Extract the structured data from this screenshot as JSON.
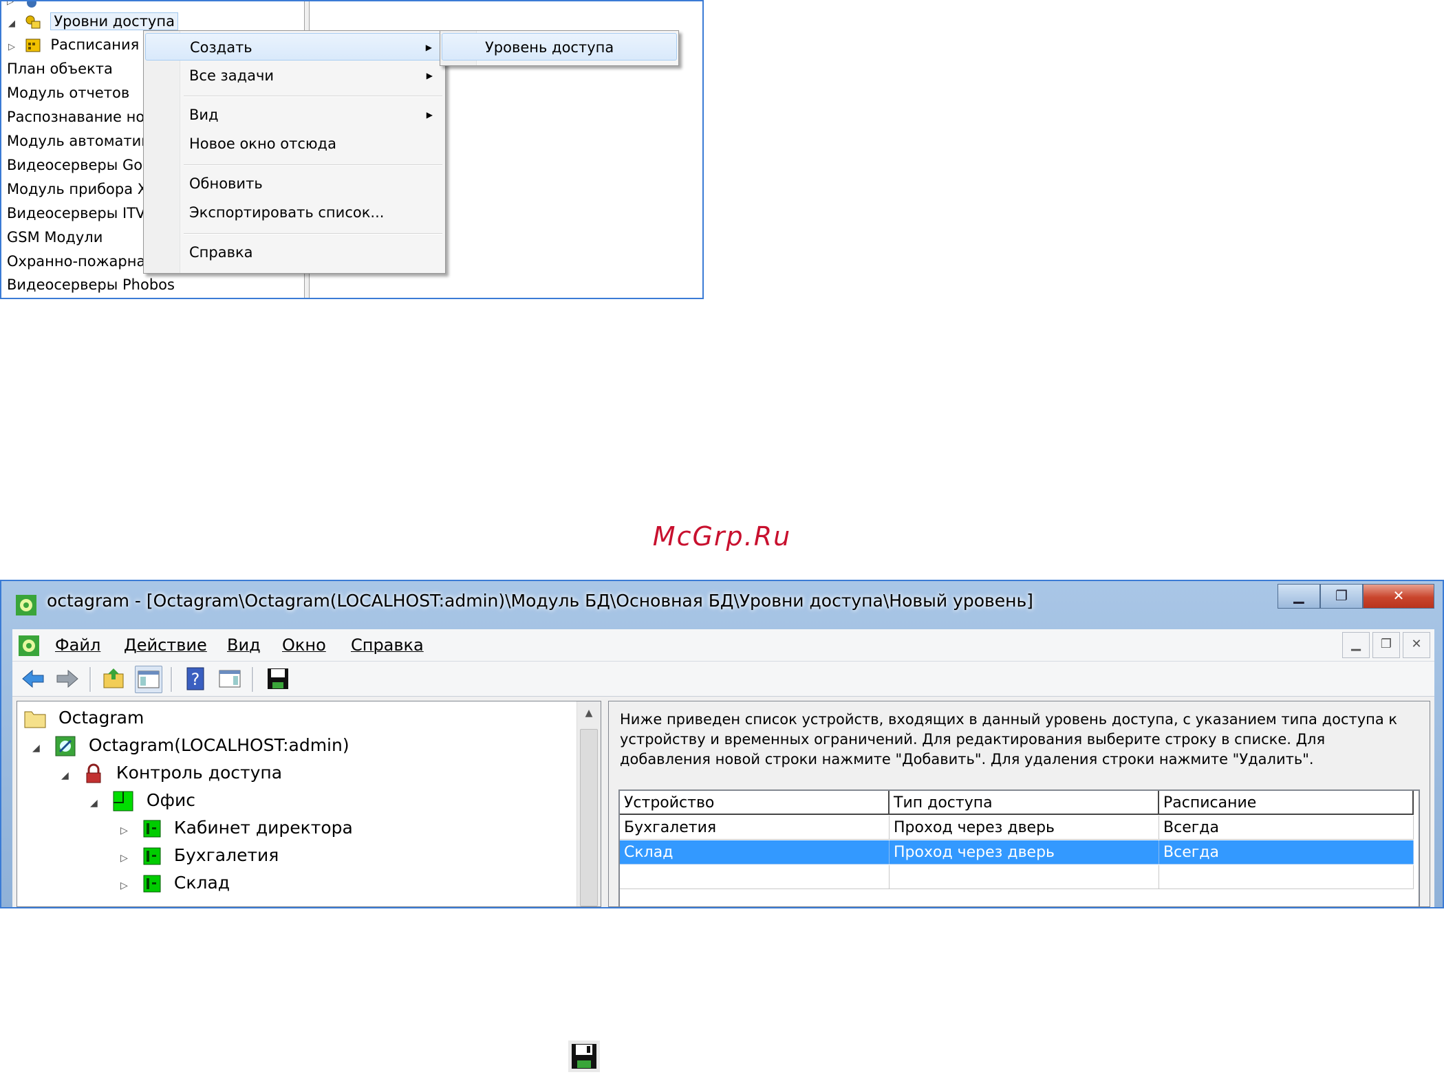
{
  "shot1": {
    "tree": {
      "access_levels": "Уровни доступа",
      "schedules": "Расписания",
      "items": [
        "План объекта",
        "Модуль отчетов",
        "Распознавание но",
        "Модуль автоматик",
        "Видеосерверы Goa",
        "Модуль прибора Х",
        "Видеосерверы ITV/",
        "GSM Модули",
        "Охранно-пожарна",
        "Видеосерверы Phobos"
      ]
    },
    "context_menu": {
      "create": "Создать",
      "all_tasks": "Все задачи",
      "view": "Вид",
      "new_window": "Новое окно отсюда",
      "refresh": "Обновить",
      "export": "Экспортировать список...",
      "help": "Справка"
    },
    "submenu": {
      "access_level": "Уровень доступа"
    }
  },
  "watermark": "McGrp.Ru",
  "shot2": {
    "title": "octagram - [Octagram\\Octagram(LOCALHOST:admin)\\Модуль БД\\Основная БД\\Уровни доступа\\Новый уровень]",
    "menu": {
      "file": "Файл",
      "action": "Действие",
      "view": "Вид",
      "window": "Окно",
      "help": "Справка"
    },
    "tree": {
      "root": "Octagram",
      "server": "Octagram(LOCALHOST:admin)",
      "access_control": "Контроль доступа",
      "office": "Офис",
      "children": [
        "Кабинет директора",
        "Бухгалетия",
        "Склад"
      ]
    },
    "description": "Ниже приведен список устройств, входящих в данный уровень доступа, с указанием типа доступа к устройству и временных ограничений. Для редактирования выберите строку в списке. Для добавления новой строки нажмите \"Добавить\". Для удаления строки нажмите \"Удалить\".",
    "table": {
      "headers": [
        "Устройство",
        "Тип доступа",
        "Расписание"
      ],
      "rows": [
        [
          "Бухгалетия",
          "Проход через дверь",
          "Всегда"
        ],
        [
          "Склад",
          "Проход через дверь",
          "Всегда"
        ]
      ],
      "selected_row": 1
    },
    "colors": {
      "selection": "#3399ff",
      "green_device": "#00cc00"
    }
  },
  "icons": {
    "standalone": "save-icon"
  }
}
